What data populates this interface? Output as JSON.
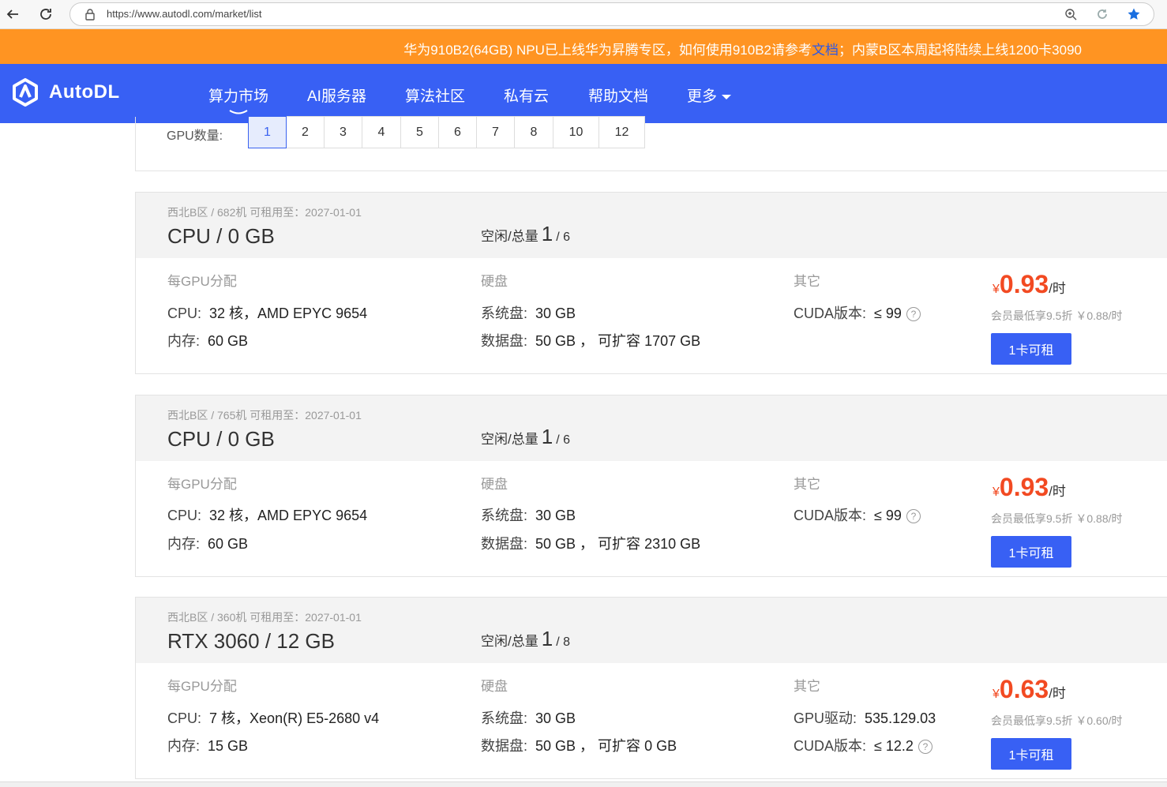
{
  "browser": {
    "url": "https://www.autodl.com/market/list"
  },
  "notice": {
    "text_before": "华为910B2(64GB) NPU已上线华为昇腾专区，如何使用910B2请参考",
    "link": "文档",
    "text_after": "；内蒙B区本周起将陆续上线1200卡3090"
  },
  "header": {
    "logo_text": "AutoDL",
    "nav": [
      "算力市场",
      "AI服务器",
      "算法社区",
      "私有云",
      "帮助文档",
      "更多"
    ]
  },
  "filter": {
    "label": "GPU数量:",
    "options": [
      "1",
      "2",
      "3",
      "4",
      "5",
      "6",
      "7",
      "8",
      "10",
      "12"
    ],
    "selected": "1"
  },
  "labels": {
    "avail": "空闲/总量",
    "per_gpu": "每GPU分配",
    "disk": "硬盘",
    "other": "其它",
    "cpu": "CPU:",
    "mem": "内存:",
    "sys_disk": "系统盘:",
    "data_disk": "数据盘:",
    "cuda": "CUDA版本:",
    "driver": "GPU驱动:",
    "currency": "¥",
    "per_hour": "/时",
    "help": "?"
  },
  "machines": [
    {
      "meta": "西北B区 / 682机   可租用至：2027-01-01",
      "title": "CPU / 0 GB",
      "free": "1",
      "total": "/ 6",
      "cpu": "32 核，AMD EPYC 9654",
      "memory": "60 GB",
      "sys_disk": "30 GB",
      "data_disk": "50 GB ， 可扩容 1707 GB",
      "cuda": "≤ 99",
      "price": "0.93",
      "member": "会员最低享9.5折 ￥0.88/时",
      "button": "1卡可租"
    },
    {
      "meta": "西北B区 / 765机   可租用至：2027-01-01",
      "title": "CPU / 0 GB",
      "free": "1",
      "total": "/ 6",
      "cpu": "32 核，AMD EPYC 9654",
      "memory": "60 GB",
      "sys_disk": "30 GB",
      "data_disk": "50 GB ， 可扩容 2310 GB",
      "cuda": "≤ 99",
      "price": "0.93",
      "member": "会员最低享9.5折 ￥0.88/时",
      "button": "1卡可租"
    },
    {
      "meta": "西北B区 / 360机   可租用至：2027-01-01",
      "title": "RTX 3060 / 12 GB",
      "free": "1",
      "total": "/ 8",
      "cpu": "7 核，Xeon(R) E5-2680 v4",
      "memory": "15 GB",
      "sys_disk": "30 GB",
      "data_disk": "50 GB ， 可扩容 0 GB",
      "driver": "535.129.03",
      "cuda": "≤ 12.2",
      "price": "0.63",
      "member": "会员最低享9.5折 ￥0.60/时",
      "button": "1卡可租"
    }
  ]
}
